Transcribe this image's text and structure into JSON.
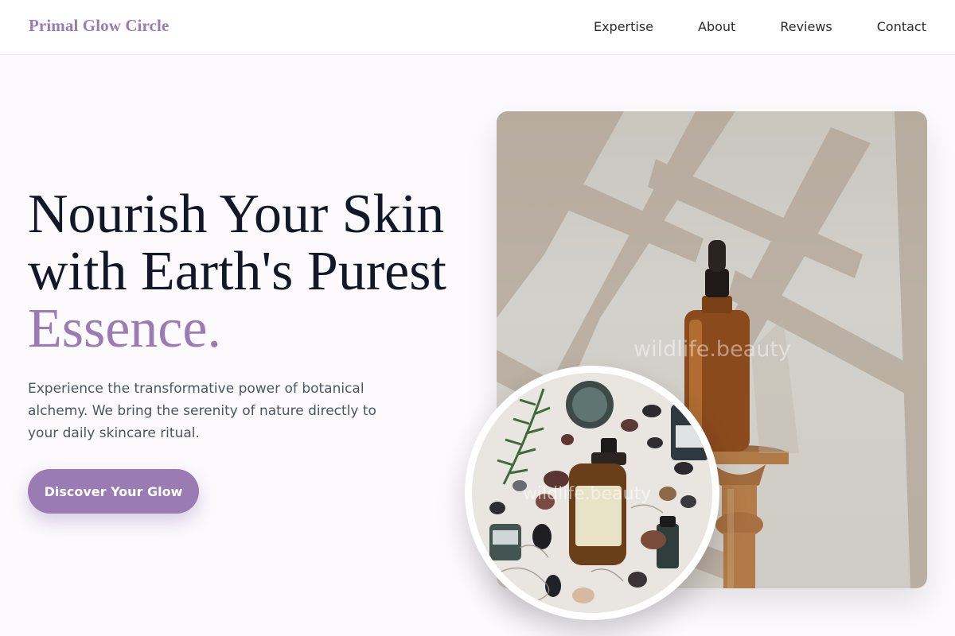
{
  "header": {
    "brand": "Primal Glow Circle",
    "nav": [
      "Expertise",
      "About",
      "Reviews",
      "Contact"
    ]
  },
  "hero": {
    "title_line1": "Nourish Your Skin",
    "title_line2": "with Earth's Purest",
    "title_accent": "Essence.",
    "lead": "Experience the transformative power of botanical alchemy. We bring the serenity of nature directly to your daily skincare ritual.",
    "cta_label": "Discover Your Glow"
  },
  "images": {
    "main_watermark": "wildlife.beauty",
    "circle_watermark": "wildlife.beauty"
  },
  "colors": {
    "accent": "#9a7bb3",
    "heading": "#111827",
    "body_text": "#4b5563",
    "background": "#fcfafd"
  }
}
